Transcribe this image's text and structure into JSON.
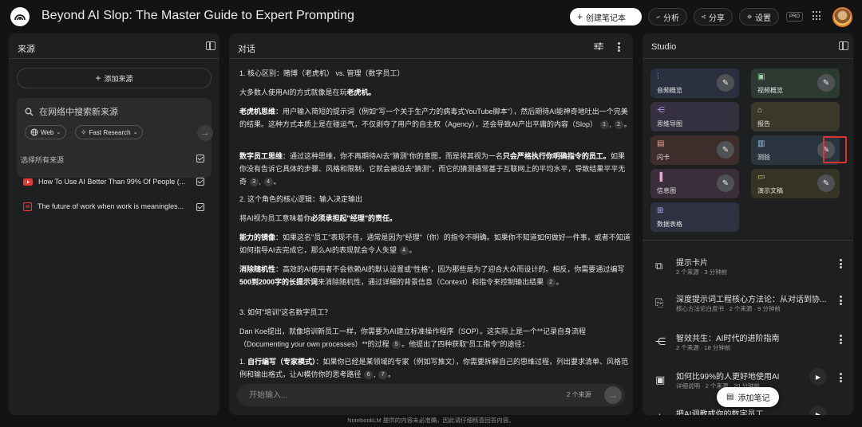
{
  "app": {
    "title": "Beyond AI Slop: The Master Guide to Expert Prompting",
    "create_notebook": "创建笔记本",
    "analytics": "分析",
    "share": "分享",
    "settings": "设置",
    "pro_badge": "PRO"
  },
  "sources": {
    "title": "来源",
    "add_label": "添加来源",
    "search_placeholder": "在网络中搜索新来源",
    "web_chip": "Web",
    "research_chip": "Fast Research",
    "select_all": "选择所有来源",
    "items": [
      {
        "label": "How To Use AI Better Than 99% Of People (...",
        "icon": "youtube-icon"
      },
      {
        "label": "The future of work when work is meaningles...",
        "icon": "document-icon"
      }
    ]
  },
  "chat": {
    "title": "对话",
    "input_placeholder": "开始输入...",
    "source_count": "2 个来源",
    "paragraphs": [
      "1. 核心区别：赌博（老虎机） vs. 管理（数字员工）",
      "大多数人使用AI的方式就像是在玩老虎机。",
      "• 老虎机思维：用户输入简短的提示词（例如\"写一个关于生产力的病毒式YouTube脚本\"），然后期待AI能神奇地吐出一个完美的结果。这种方式本质上是在碰运气，不仅剥夺了用户的自主权（Agency），还会导致AI产出平庸的内容（Slop）",
      "• 数字员工思维：通过这种思维，你不再期待AI去\"猜测\"你的意图，而是将其视为一名只会严格执行你明确指令的员工。如果你没有告诉它具体的步骤、风格和限制，它就会被迫去\"猜测\"，而它的猜测通常基于互联网上的平均水平，导致结果平平无奇",
      "2. 这个角色的核心逻辑：输入决定输出",
      "将AI视为员工意味着你必须承担起\"经理\"的责任。",
      "• 能力的镜像：如果这名\"员工\"表现不佳，通常是因为\"经理\"（你）的指令不明确。如果你不知道如何做好一件事，或者不知道如何指导AI去完成它，那么AI的表现就会令人失望",
      "• 消除随机性：高效的AI使用者不会依赖AI的默认设置或\"性格\"，因为那些是为了迎合大众而设计的。相反，你需要通过编写500到2000字的长提示词来消除随机性，通过详细的背景信息（Context）和指令来控制输出结果",
      "3. 如何\"培训\"这名数字员工？",
      "Dan Koe提出，就像培训新员工一样，你需要为AI建立标准操作程序（SOP）。这实际上是一个**记录自身流程（Documenting your own processes）**的过程",
      "1. 自行编写（专家模式）：如果你已经是某领域的专家（例如写推文），你需要拆解自己的思维过程，列出要求清单、风格范例和输出格式，让AI模仿你的思考路径"
    ],
    "bold_phrases": [
      "老虎机。",
      "老虎机思维",
      "数字员工思维",
      "只会严格执行你明确指令的员工。",
      "必须承担起\"经理\"的责任。",
      "能力的镜像",
      "消除随机性",
      "500到2000字的长提示词",
      "自行编写（专家模式）"
    ],
    "citations": [
      "1",
      "2",
      "3",
      "4",
      "4",
      "2",
      "5",
      "6",
      "7"
    ]
  },
  "studio": {
    "title": "Studio",
    "tiles": [
      {
        "label": "音频概览",
        "icon": "audio-wave-icon"
      },
      {
        "label": "视频概览",
        "icon": "video-icon"
      },
      {
        "label": "思维导图",
        "icon": "mindmap-icon"
      },
      {
        "label": "报告",
        "icon": "report-icon"
      },
      {
        "label": "闪卡",
        "icon": "flashcard-icon"
      },
      {
        "label": "测验",
        "icon": "quiz-icon"
      },
      {
        "label": "信息图",
        "icon": "infographic-icon"
      },
      {
        "label": "演示文稿",
        "icon": "slides-icon"
      },
      {
        "label": "数据表格",
        "icon": "table-icon"
      }
    ],
    "notes": [
      {
        "title": "提示卡片",
        "meta": "2 个来源 · 3 分钟前"
      },
      {
        "title": "深度提示词工程核心方法论：从对话到协...",
        "meta": "核心方法论白皮书 · 2 个来源 · 9 分钟前"
      },
      {
        "title": "智效共生：AI时代的进阶指南",
        "meta": "2 个来源 · 18 分钟前"
      },
      {
        "title": "如何比99%的人更好地使用AI",
        "meta": "详细说明 · 2 个来源 · 20 分钟前"
      },
      {
        "title": "把AI调教成你的数字员工",
        "meta": ""
      }
    ],
    "add_note": "添加笔记"
  },
  "footer": "NotebookLM 提供的内容未必准确，因此请仔细核查回答内容。",
  "colors": {
    "background": "#131314",
    "panel": "#1e1f20",
    "tile_audio": "#2b3040",
    "tile_video": "#2d3a31",
    "tile_mindmap": "#35303f",
    "tile_report": "#3a382a",
    "tile_flashcard": "#3e2e2b",
    "tile_quiz": "#2b3540",
    "highlight": "#e03030"
  }
}
